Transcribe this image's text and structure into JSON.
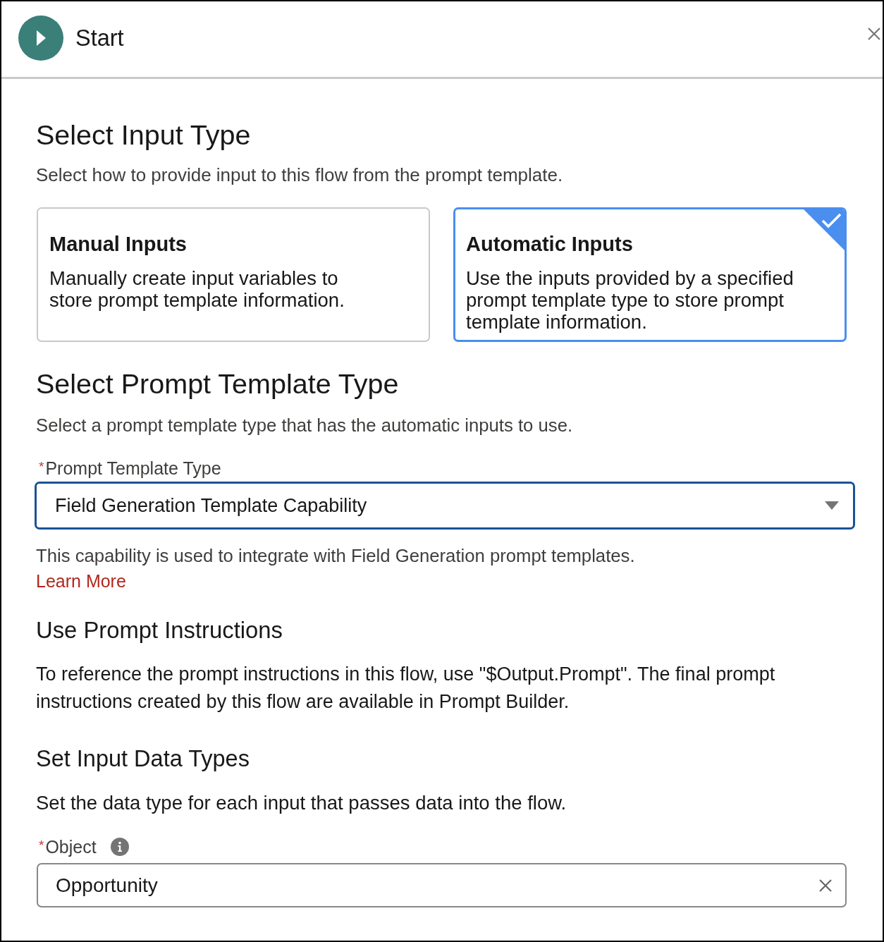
{
  "header": {
    "title": "Start"
  },
  "input_type": {
    "heading": "Select Input Type",
    "description": "Select how to provide input to this flow from the prompt template.",
    "options": [
      {
        "title": "Manual Inputs",
        "description": "Manually create input variables to store prompt template information.",
        "selected": false
      },
      {
        "title": "Automatic Inputs",
        "description": "Use the inputs provided by a specified prompt template type to store prompt template information.",
        "selected": true
      }
    ]
  },
  "prompt_template": {
    "heading": "Select Prompt Template Type",
    "description": "Select a prompt template type that has the automatic inputs to use.",
    "field": {
      "required_mark": "*",
      "label": "Prompt Template Type",
      "value": "Field Generation Template Capability"
    },
    "help_text": "This capability is used to integrate with Field Generation prompt templates.",
    "link": "Learn More"
  },
  "instructions": {
    "heading": "Use Prompt Instructions",
    "text": "To reference the prompt instructions in this flow, use \"$Output.Prompt\". The final prompt instructions created by this flow are available in Prompt Builder."
  },
  "data_types": {
    "heading": "Set Input Data Types",
    "description": "Set the data type for each input that passes data into the flow.",
    "field": {
      "required_mark": "*",
      "label": "Object",
      "value": "Opportunity"
    }
  }
}
